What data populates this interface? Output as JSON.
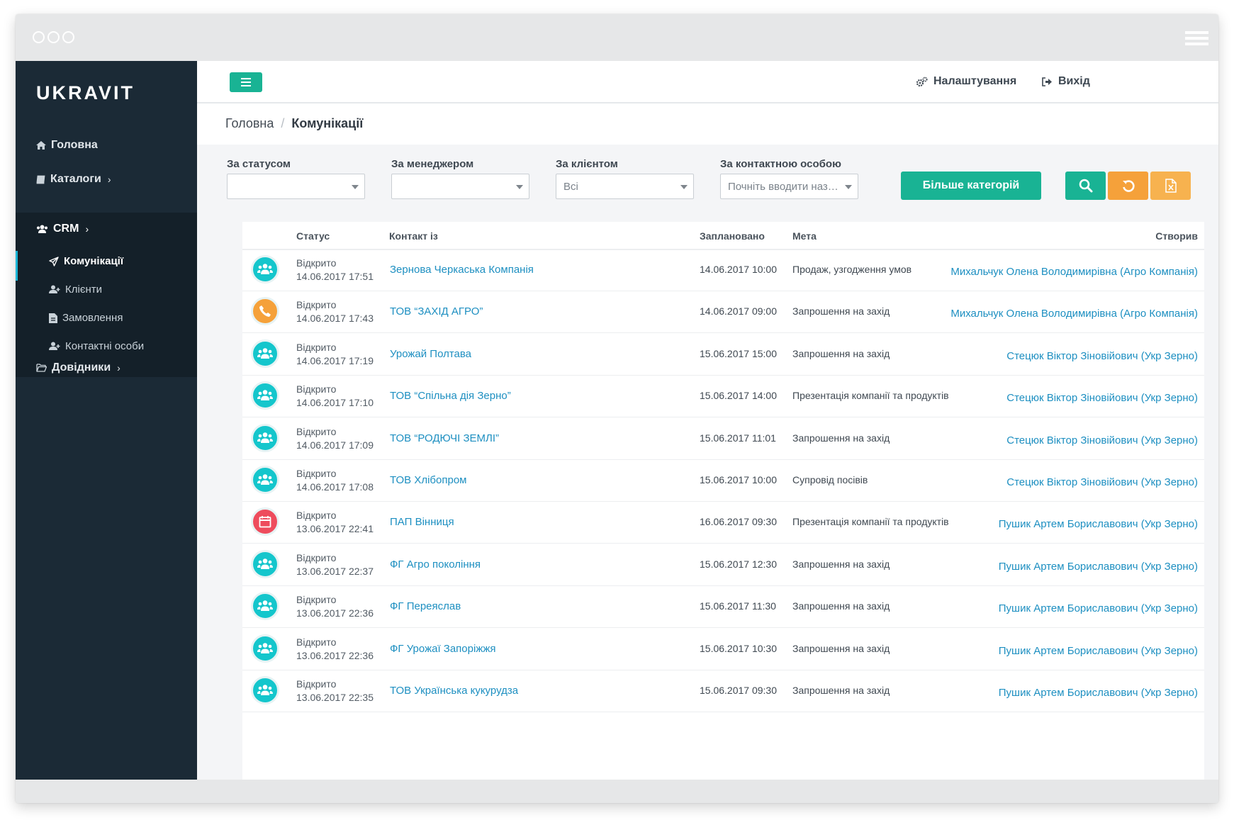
{
  "app": {
    "logo": "UKRAVIT"
  },
  "sidebar": {
    "items": [
      {
        "label": "Головна",
        "icon": "home-icon"
      },
      {
        "label": "Каталоги",
        "icon": "book-icon",
        "chevron": "›"
      },
      {
        "label": "CRM",
        "icon": "users-icon",
        "chevron": "›"
      },
      {
        "label": "Довідники",
        "icon": "folder-icon",
        "chevron": "›"
      }
    ],
    "crm_items": [
      {
        "label": "Комунікації",
        "icon": "paper-plane-icon",
        "active": true
      },
      {
        "label": "Клієнти",
        "icon": "user-plus-icon"
      },
      {
        "label": "Замовлення",
        "icon": "file-icon"
      },
      {
        "label": "Контактні особи",
        "icon": "user-plus-icon"
      }
    ]
  },
  "topbar": {
    "settings_label": "Налаштування",
    "logout_label": "Вихід"
  },
  "breadcrumb": {
    "home": "Головна",
    "separator": "/",
    "current": "Комунікації"
  },
  "filters": {
    "status_label": "За статусом",
    "status_value": "",
    "manager_label": "За менеджером",
    "manager_value": "",
    "client_label": "За клієнтом",
    "client_value": "Всі",
    "contact_label": "За контактною особою",
    "contact_placeholder": "Почніть вводити назв...",
    "more_button": "Більше категорій"
  },
  "colors": {
    "accent_green": "#19b394",
    "orange": "#f5a13a",
    "light_orange": "#f7b24f",
    "meeting_teal": "#14c6cc",
    "event_red": "#ee4c5d",
    "link_blue": "#1d8fc1",
    "sidebar_bg": "#1b2a36"
  },
  "table": {
    "headers": {
      "status": "Статус",
      "contact": "Контакт із",
      "planned": "Заплановано",
      "goal": "Мета",
      "creator": "Створив"
    },
    "rows": [
      {
        "type": "meeting",
        "status": "Відкрито",
        "created": "14.06.2017 17:51",
        "contact": "Зернова Черкаська Компанія",
        "planned": "14.06.2017 10:00",
        "goal": "Продаж, узгодження умов",
        "creator": "Михальчук Олена Володимирівна (Агро Компанія)"
      },
      {
        "type": "call",
        "status": "Відкрито",
        "created": "14.06.2017 17:43",
        "contact": "ТОВ “ЗАХІД АГРО”",
        "planned": "14.06.2017 09:00",
        "goal": "Запрошення на захід",
        "creator": "Михальчук Олена Володимирівна (Агро Компанія)"
      },
      {
        "type": "meeting",
        "status": "Відкрито",
        "created": "14.06.2017 17:19",
        "contact": "Урожай Полтава",
        "planned": "15.06.2017 15:00",
        "goal": "Запрошення на захід",
        "creator": "Стецюк Віктор Зіновійович (Укр Зерно)"
      },
      {
        "type": "meeting",
        "status": "Відкрито",
        "created": "14.06.2017 17:10",
        "contact": "ТОВ “Спільна дія Зерно”",
        "planned": "15.06.2017 14:00",
        "goal": "Презентація компанії та продуктів",
        "creator": "Стецюк Віктор Зіновійович (Укр Зерно)"
      },
      {
        "type": "meeting",
        "status": "Відкрито",
        "created": "14.06.2017 17:09",
        "contact": "ТОВ “РОДЮЧІ ЗЕМЛІ”",
        "planned": "15.06.2017 11:01",
        "goal": "Запрошення на захід",
        "creator": "Стецюк Віктор Зіновійович (Укр Зерно)"
      },
      {
        "type": "meeting",
        "status": "Відкрито",
        "created": "14.06.2017 17:08",
        "contact": "ТОВ Хлібопром",
        "planned": "15.06.2017 10:00",
        "goal": "Супровід посівів",
        "creator": "Стецюк Віктор Зіновійович (Укр Зерно)"
      },
      {
        "type": "event",
        "status": "Відкрито",
        "created": "13.06.2017 22:41",
        "contact": "ПАП Вінниця",
        "planned": "16.06.2017 09:30",
        "goal": "Презентація компанії та продуктів",
        "creator": "Пушик Артем Бориславович (Укр Зерно)"
      },
      {
        "type": "meeting",
        "status": "Відкрито",
        "created": "13.06.2017 22:37",
        "contact": "ФГ Агро покоління",
        "planned": "15.06.2017 12:30",
        "goal": "Запрошення на захід",
        "creator": "Пушик Артем Бориславович (Укр Зерно)"
      },
      {
        "type": "meeting",
        "status": "Відкрито",
        "created": "13.06.2017 22:36",
        "contact": "ФГ Переяслав",
        "planned": "15.06.2017 11:30",
        "goal": "Запрошення на захід",
        "creator": "Пушик Артем Бориславович (Укр Зерно)"
      },
      {
        "type": "meeting",
        "status": "Відкрито",
        "created": "13.06.2017 22:36",
        "contact": "ФГ Урожаї Запоріжжя",
        "planned": "15.06.2017 10:30",
        "goal": "Запрошення на захід",
        "creator": "Пушик Артем Бориславович (Укр Зерно)"
      },
      {
        "type": "meeting",
        "status": "Відкрито",
        "created": "13.06.2017 22:35",
        "contact": "ТОВ Українська кукурудза",
        "planned": "15.06.2017 09:30",
        "goal": "Запрошення на захід",
        "creator": "Пушик Артем Бориславович (Укр Зерно)"
      }
    ]
  }
}
